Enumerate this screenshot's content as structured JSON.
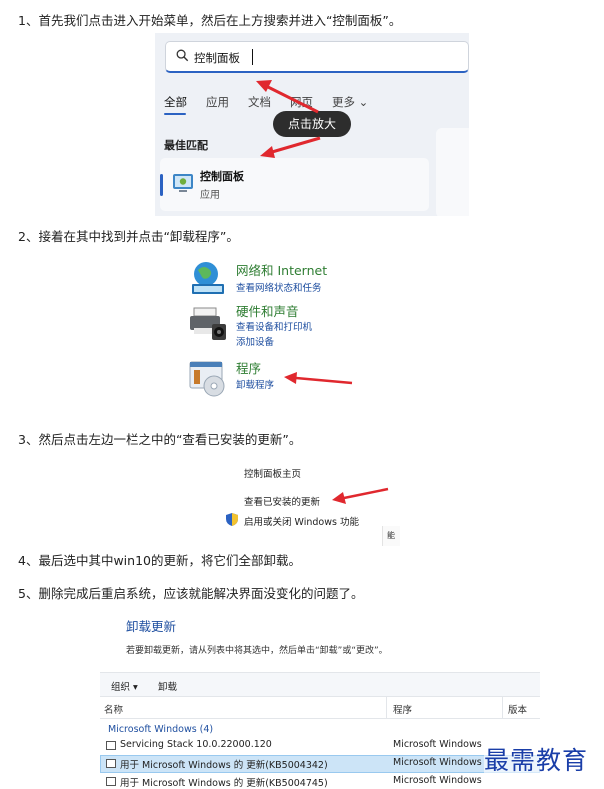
{
  "steps": {
    "s1": "1、首先我们点击进入开始菜单，然后在上方搜索并进入“控制面板”。",
    "s2": "2、接着在其中找到并点击“卸载程序”。",
    "s3": "3、然后点击左边一栏之中的“查看已安装的更新”。",
    "s4": "4、最后选中其中win10的更新，将它们全部卸载。",
    "s5": "5、删除完成后重启系统，应该就能解决界面没变化的问题了。"
  },
  "search_panel": {
    "query": "控制面板",
    "tabs": [
      "全部",
      "应用",
      "文档",
      "网页",
      "更多 ⌄"
    ],
    "section": "最佳匹配",
    "result_title": "控制面板",
    "result_sub": "应用",
    "tooltip": "点击放大"
  },
  "categories": {
    "network_title": "网络和 Internet",
    "network_link": "查看网络状态和任务",
    "hardware_title": "硬件和声音",
    "hardware_link1": "查看设备和打印机",
    "hardware_link2": "添加设备",
    "programs_title": "程序",
    "programs_link": "卸载程序"
  },
  "sidebar": {
    "home": "控制面板主页",
    "view_updates": "查看已安装的更新",
    "features": "启用或关闭 Windows 功能",
    "fragment": "能"
  },
  "uninstall": {
    "title": "卸载更新",
    "desc": "若要卸载更新，请从列表中将其选中，然后单击“卸载”或“更改”。",
    "toolbar_organize": "组织 ▾",
    "toolbar_uninstall": "卸载",
    "col_name": "名称",
    "col_program": "程序",
    "col_version": "版本",
    "group": "Microsoft Windows (4)",
    "rows": [
      {
        "name": "Servicing Stack 10.0.22000.120",
        "program": "Microsoft Windows"
      },
      {
        "name": "用于 Microsoft Windows 的 更新(KB5004342)",
        "program": "Microsoft Windows"
      },
      {
        "name": "用于 Microsoft Windows 的 更新(KB5004745)",
        "program": "Microsoft Windows"
      }
    ]
  },
  "watermark": "最需教育",
  "colors": {
    "accent_blue": "#2b62c2",
    "arrow_red": "#e0282e",
    "category_green": "#2e7d32",
    "link_blue": "#1f4fa0",
    "row_selected": "#cce4f7"
  }
}
